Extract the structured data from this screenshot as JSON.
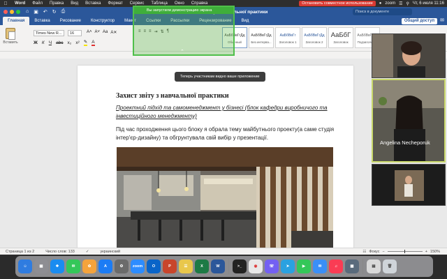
{
  "menubar": {
    "app": "Word",
    "items": [
      "Файл",
      "Правка",
      "Вид",
      "Вставка",
      "Формат",
      "Сервис",
      "Таблица",
      "Окно",
      "Справка"
    ],
    "stop_share": "Остановить совместное использование",
    "zoom_app": "zoom",
    "datetime": "Чт, 6 июля 11:16"
  },
  "window": {
    "title": "Захист звіту з навчальної практики",
    "search_placeholder": "Поиск в документе"
  },
  "ribbon": {
    "tabs": [
      "Главная",
      "Вставка",
      "Рисование",
      "Конструктор",
      "Макет",
      "Ссылки",
      "Рассылки",
      "Рецензирование",
      "Вид"
    ],
    "active_tab": "Главная",
    "share_label": "Общий доступ",
    "paste_label": "Вставить",
    "font_name": "Times New R...",
    "font_size": "16",
    "styles": [
      {
        "sample": "АаБбВвГгДд",
        "name": "Обычный"
      },
      {
        "sample": "АаБбВвГгДд",
        "name": "Без интерва..."
      },
      {
        "sample": "АаБбВвГг",
        "name": "Заголовок 1"
      },
      {
        "sample": "АаБбВвГгДд",
        "name": "Заголовок 2"
      },
      {
        "sample": "АаБбГ",
        "name": "Заголовок"
      },
      {
        "sample": "АаБбВвГгДд",
        "name": "Подзаголовок"
      }
    ]
  },
  "zoom": {
    "share_banner": "Вы запустили демонстрацию экрана",
    "toast": "Теперь участникам видно ваше приложение",
    "participant_name": "Angelina Necheporuk"
  },
  "document": {
    "heading": "Захист звіту з навчальної практики",
    "subtitle": "Проектний підхід та самоменеджмент у бізнесі (блок кафедри виробничого та інвестиційного менеджменту)",
    "body": "Під час проходження цього блоку я обрала тему майбутнього проекту(а саме студія інтер'єр-дизайну) та обгрунтувала свій вибір у презентації."
  },
  "statusbar": {
    "page": "Страница 1 из 2",
    "words": "Число слов: 133",
    "language": "украинский",
    "focus": "Фокус",
    "zoom": "150%"
  },
  "dock": {
    "apps": [
      "finder",
      "launchpad",
      "safari",
      "messages",
      "photos",
      "app-store",
      "system-settings",
      "zoom",
      "outlook",
      "powerpoint",
      "notes",
      "excel",
      "word",
      "terminal",
      "chrome",
      "viber",
      "telegram",
      "facetime",
      "mail",
      "music",
      "preview",
      "finder-folder",
      "trash"
    ]
  }
}
